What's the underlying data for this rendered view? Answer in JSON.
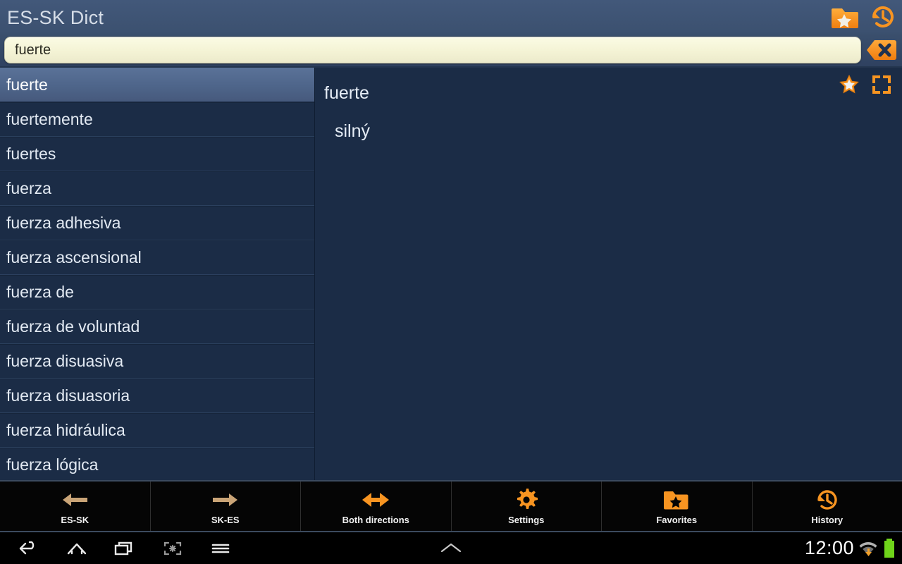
{
  "header": {
    "title": "ES-SK Dict",
    "favorites_icon": "folder-star-icon",
    "history_icon": "history-clock-icon"
  },
  "search": {
    "value": "fuerte",
    "placeholder": "",
    "clear_icon": "clear-x-icon"
  },
  "word_list": {
    "selected_index": 0,
    "items": [
      {
        "label": "fuerte"
      },
      {
        "label": "fuertemente"
      },
      {
        "label": "fuertes"
      },
      {
        "label": "fuerza"
      },
      {
        "label": "fuerza adhesiva"
      },
      {
        "label": "fuerza ascensional"
      },
      {
        "label": "fuerza de"
      },
      {
        "label": "fuerza de voluntad"
      },
      {
        "label": "fuerza disuasiva"
      },
      {
        "label": "fuerza disuasoria"
      },
      {
        "label": "fuerza hidráulica"
      },
      {
        "label": "fuerza lógica"
      }
    ]
  },
  "definition": {
    "headword": "fuerte",
    "translation": "silný",
    "star_icon": "star-icon",
    "fullscreen_icon": "fullscreen-icon"
  },
  "toolbar": {
    "items": [
      {
        "label": "ES-SK",
        "icon": "arrow-left-icon",
        "active": false
      },
      {
        "label": "SK-ES",
        "icon": "arrow-right-icon",
        "active": false
      },
      {
        "label": "Both directions",
        "icon": "arrow-both-icon",
        "active": true
      },
      {
        "label": "Settings",
        "icon": "gear-icon",
        "active": true
      },
      {
        "label": "Favorites",
        "icon": "folder-star-icon",
        "active": true
      },
      {
        "label": "History",
        "icon": "history-clock-icon",
        "active": true
      }
    ]
  },
  "navbar": {
    "back_icon": "back-icon",
    "home_icon": "home-icon",
    "recents_icon": "recents-icon",
    "screenshot_icon": "screenshot-icon",
    "menu_icon": "menu-icon",
    "expand_icon": "chevron-up-icon",
    "clock": "12:00",
    "wifi_icon": "wifi-download-icon",
    "battery_icon": "battery-full-icon"
  },
  "colors": {
    "accent_orange": "#f79421",
    "header_blue": "#3c5170",
    "panel_navy": "#1b2c46",
    "search_cream": "#f4f3d5",
    "dim_arrow": "#c9a477",
    "battery_green": "#6fd41a"
  }
}
